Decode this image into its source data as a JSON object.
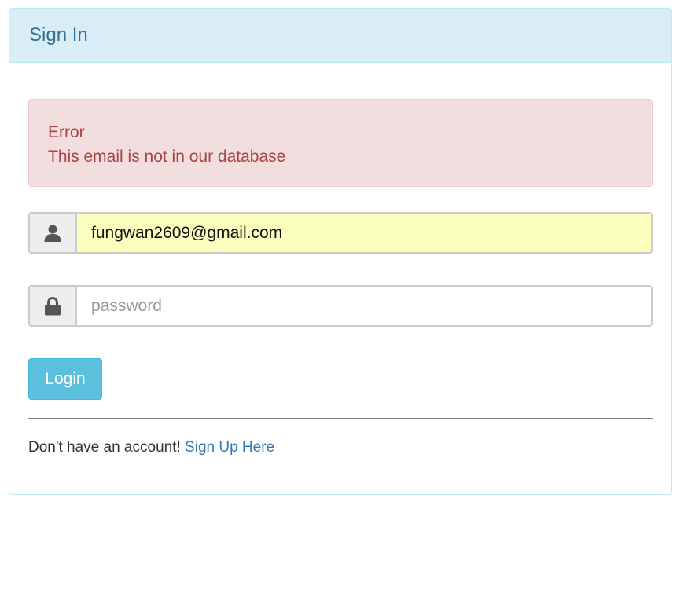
{
  "panel": {
    "title": "Sign In"
  },
  "alert": {
    "title": "Error",
    "message": "This email is not in our database"
  },
  "email": {
    "icon": "user-icon",
    "value": "fungwan2609@gmail.com"
  },
  "password": {
    "icon": "lock-icon",
    "placeholder": "password",
    "value": ""
  },
  "login_button": {
    "label": "Login"
  },
  "footer": {
    "text": "Don't have an account!",
    "link_text": "Sign Up Here"
  },
  "colors": {
    "heading_bg": "#d9edf7",
    "heading_text": "#31708f",
    "alert_bg": "#f2dede",
    "alert_text": "#a94442",
    "button_bg": "#5bc0de",
    "link": "#337ab7",
    "autofill_bg": "#faffbd"
  }
}
